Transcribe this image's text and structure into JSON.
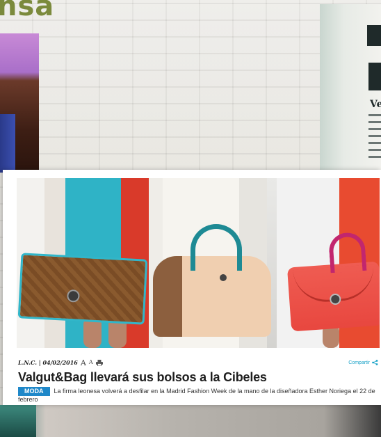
{
  "background": {
    "headline_fragment": "nsa",
    "paper_fragment": "Ve"
  },
  "article": {
    "byline": "L.N.C. | 04/02/2016",
    "font_larger": "A",
    "font_smaller": "A",
    "share_label": "Compartir",
    "headline": "Valgut&Bag llevará sus bolsos a la Cibeles",
    "section": "MODA",
    "lede": "La firma leonesa volverá a desfilar en la Madrid Fashion Week de la mano de la diseñadora Esther Noriega el 22 de febrero",
    "accent_color": "#1f88c9",
    "share_color": "#1aa3c8",
    "icons": [
      "print-icon",
      "share-icon"
    ]
  }
}
